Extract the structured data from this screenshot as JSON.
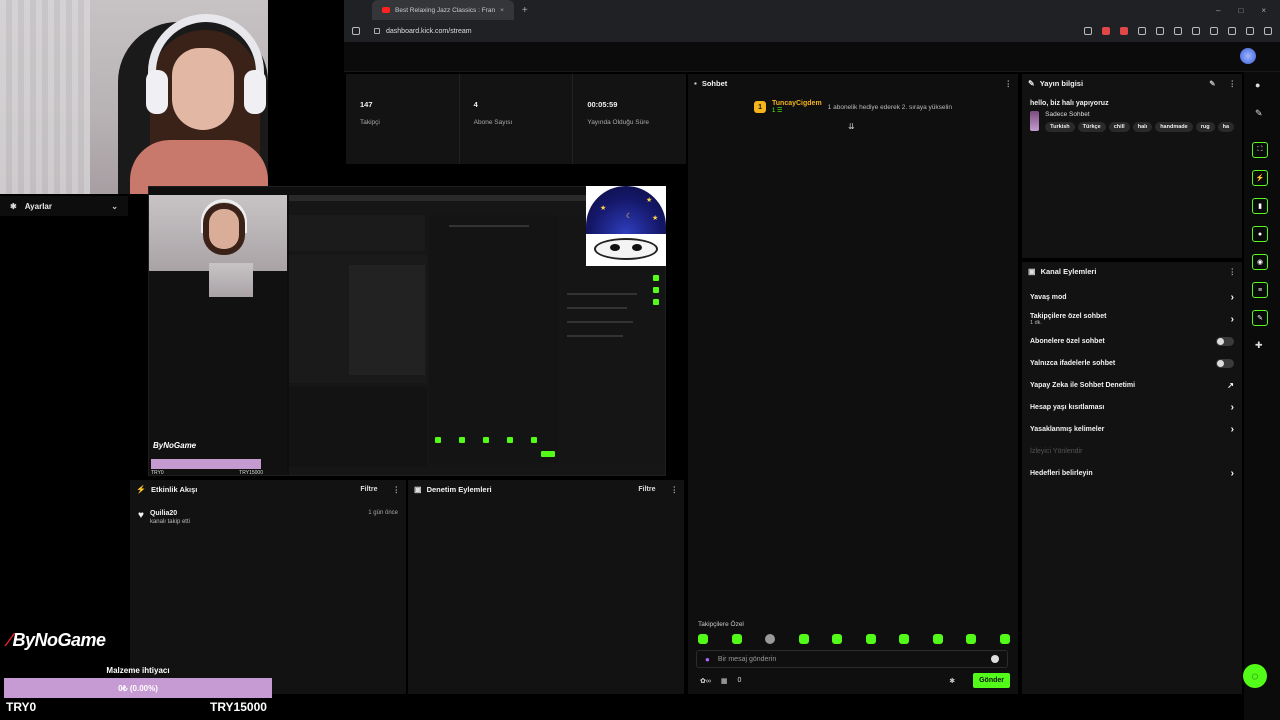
{
  "browser": {
    "tab_title": "Best Relaxing Jazz Classics : Fran",
    "tab_close": "×",
    "new_tab": "+",
    "url": "dashboard.kick.com/stream",
    "window_buttons": [
      "–",
      "□",
      "×"
    ]
  },
  "stats": [
    {
      "value": "147",
      "label": "Takipçi"
    },
    {
      "value": "4",
      "label": "Abone Sayısı"
    },
    {
      "value": "00:05:59",
      "label": "Yayında Olduğu Süre"
    }
  ],
  "settings": {
    "title": "Ayarlar",
    "chevron": "⌄"
  },
  "activity": {
    "title": "Etkinlik Akışı",
    "filter": "Filtre",
    "items": [
      {
        "name": "Quilia20",
        "action": "kanalı takip etti",
        "time": "1 gün önce"
      }
    ]
  },
  "moderation": {
    "title": "Denetim Eylemleri",
    "filter": "Filtre"
  },
  "chat": {
    "title": "Sohbet",
    "pinned": {
      "badge": "1",
      "user": "TuncayCigdem",
      "user_sub": "1 ☰",
      "text": "1 abonelik hediye ederek 2. sıraya yükselin"
    },
    "emote_label": "Takipçilere Özel",
    "input_placeholder": "Bir mesaj gönderin",
    "count": "0",
    "send": "Gönder"
  },
  "info": {
    "title": "Yayın bilgisi",
    "stream_title": "hello, biz halı yapıyoruz",
    "category": "Sadece Sohbet",
    "tags": [
      "Turkish",
      "Türkçe",
      "chill",
      "halı",
      "handmade",
      "rug",
      "ha"
    ]
  },
  "actions": {
    "title": "Kanal Eylemleri",
    "items": [
      {
        "label": "Yavaş mod",
        "sub": "",
        "control": "chevron"
      },
      {
        "label": "Takipçilere özel sohbet",
        "sub": "1 dk.",
        "control": "chevron"
      },
      {
        "label": "Abonelere özel sohbet",
        "sub": "",
        "control": "toggle"
      },
      {
        "label": "Yalnızca ifadelerle sohbet",
        "sub": "",
        "control": "toggle"
      },
      {
        "label": "Yapay Zeka ile Sohbet Denetimi",
        "sub": "",
        "control": "external"
      },
      {
        "label": "Hesap yaşı kısıtlaması",
        "sub": "",
        "control": "chevron"
      },
      {
        "label": "Yasaklanmış kelimeler",
        "sub": "",
        "control": "chevron"
      },
      {
        "label": "İzleyici Yönlendir",
        "sub": "",
        "control": "none"
      },
      {
        "label": "Hedefleri belirleyin",
        "sub": "",
        "control": "chevron"
      }
    ]
  },
  "overlay": {
    "brand": "ByNoGame",
    "goal_label": "Malzeme ihtiyacı",
    "goal_value": "0₺ (0.00%)",
    "goal_progress": 0,
    "goal_min": "TRY0",
    "goal_max": "TRY15000"
  },
  "preview": {
    "brand": "ByNoGame",
    "goal_min": "TRY0",
    "goal_max": "TRY15000"
  },
  "colors": {
    "accent": "#53fc18",
    "goal": "#c69ad2",
    "pinned_user": "#f5b31c"
  }
}
